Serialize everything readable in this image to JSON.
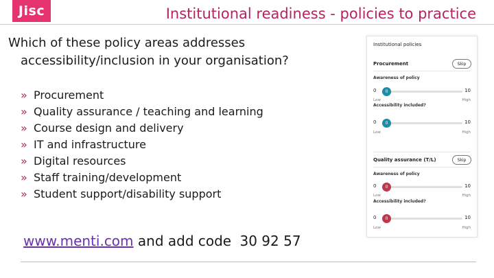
{
  "header": {
    "logo_text": "Jisc",
    "title": "Institutional readiness - policies to practice"
  },
  "question": {
    "line1": "Which of these policy areas addresses",
    "line2": "accessibility/inclusion in your organisation?"
  },
  "bullet_glyph": "»",
  "policy_areas": [
    "Procurement",
    "Quality assurance / teaching and learning",
    "Course design and delivery",
    "IT and infrastructure",
    "Digital resources",
    "Staff training/development",
    "Student support/disability support"
  ],
  "footer": {
    "link_text": "www.menti.com",
    "middle_text": "and add code",
    "code": "30 92 57"
  },
  "panel": {
    "title": "Institutional policies",
    "sections": [
      {
        "heading": "Procurement",
        "skip_label": "Skip",
        "accent": "#1a8ea6",
        "questions": [
          {
            "label": "Awareness of policy",
            "min": "0",
            "max": "10",
            "value": "0",
            "low": "Low",
            "high": "High"
          },
          {
            "label": "Accessibility included?",
            "min": "0",
            "max": "10",
            "value": "0",
            "low": "Low",
            "high": "High"
          }
        ]
      },
      {
        "heading": "Quality assurance (T/L)",
        "skip_label": "Skip",
        "accent": "#c2364a",
        "questions": [
          {
            "label": "Awareness of policy",
            "min": "0",
            "max": "10",
            "value": "0",
            "low": "Low",
            "high": "High"
          },
          {
            "label": "Accessibility included?",
            "min": "0",
            "max": "10",
            "value": "0",
            "low": "Low",
            "high": "High"
          }
        ]
      }
    ]
  },
  "colors": {
    "brand": "#e5336f",
    "title": "#b5245c",
    "link": "#6a2fb5"
  }
}
